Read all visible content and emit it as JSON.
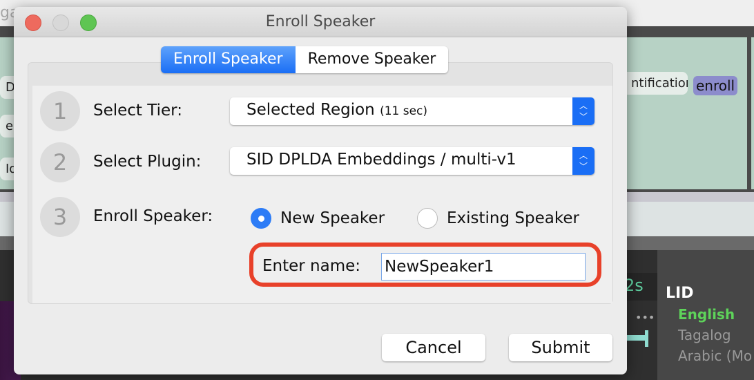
{
  "background": {
    "top_text": "ga",
    "panels": [
      "Dia",
      "e D",
      "Id"
    ],
    "right_box": "ntification",
    "enroll_tag": "enroll",
    "time": "2s",
    "dots": "•••",
    "lid": {
      "title": "LID",
      "items": [
        "English",
        "Tagalog",
        "Arabic (Mo"
      ],
      "active": "English"
    },
    "colors": {
      "panel_green": "#b7d2c5",
      "enroll_tag": "#8c8ccc",
      "lid_active": "#5ed35a"
    }
  },
  "dialog": {
    "title": "Enroll Speaker",
    "tabs": [
      {
        "label": "Enroll Speaker",
        "active": true
      },
      {
        "label": "Remove Speaker",
        "active": false
      }
    ],
    "steps": [
      {
        "num": "1",
        "label": "Select Tier:",
        "value": "Selected Region",
        "value_note": "(11 sec)"
      },
      {
        "num": "2",
        "label": "Select Plugin:",
        "value": "SID DPLDA Embeddings / multi-v1"
      },
      {
        "num": "3",
        "label": "Enroll Speaker:"
      }
    ],
    "radios": [
      {
        "label": "New Speaker",
        "checked": true
      },
      {
        "label": "Existing Speaker",
        "checked": false
      }
    ],
    "name_label": "Enter name:",
    "name_value": "NewSpeaker1",
    "cancel": "Cancel",
    "submit": "Submit",
    "colors": {
      "accent": "#1a6ef5",
      "highlight": "#e8412a"
    }
  }
}
